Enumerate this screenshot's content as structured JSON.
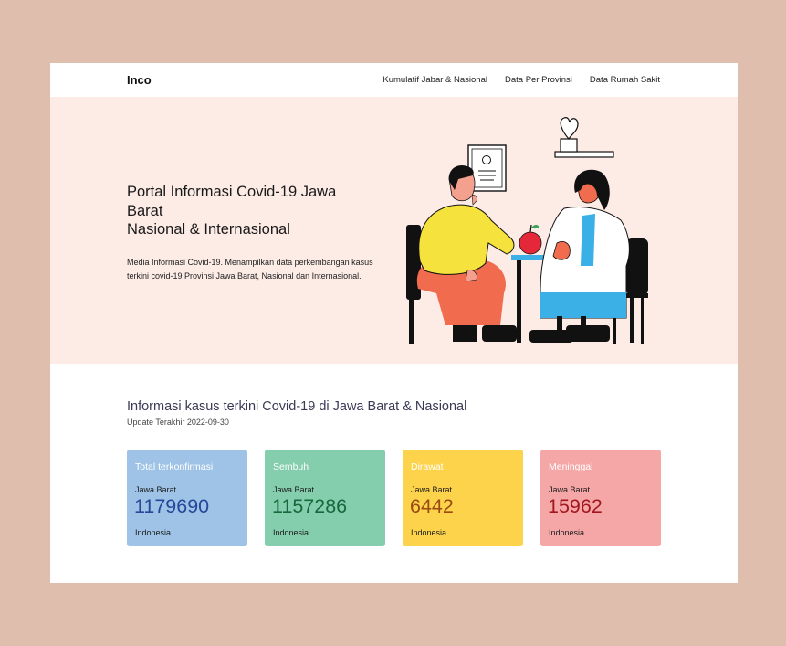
{
  "nav": {
    "brand": "Inco",
    "links": [
      "Kumulatif Jabar & Nasional",
      "Data Per Provinsi",
      "Data Rumah Sakit"
    ]
  },
  "hero": {
    "title_lines": [
      "Portal Informasi Covid-19 Jawa",
      "Barat",
      "Nasional & Internasional"
    ],
    "description": "Media Informasi Covid-19. Menampilkan data perkembangan kasus terkini covid-19 Provinsi Jawa Barat, Nasional dan Internasional."
  },
  "info": {
    "title": "Informasi kasus terkini Covid-19 di Jawa Barat & Nasional",
    "update": "Update Terakhir 2022-09-30"
  },
  "cards": [
    {
      "title": "Total terkonfirmasi",
      "region": "Jawa Barat",
      "value": "1179690",
      "footer": "Indonesia",
      "bg": "#9ec3e6",
      "value_color": "#27479a"
    },
    {
      "title": "Sembuh",
      "region": "Jawa Barat",
      "value": "1157286",
      "footer": "Indonesia",
      "bg": "#84cdad",
      "value_color": "#16693c"
    },
    {
      "title": "Dirawat",
      "region": "Jawa Barat",
      "value": "6442",
      "footer": "Indonesia",
      "bg": "#fcd34b",
      "value_color": "#9a4a12"
    },
    {
      "title": "Meninggal",
      "region": "Jawa Barat",
      "value": "15962",
      "footer": "Indonesia",
      "bg": "#f5a7a8",
      "value_color": "#a3161f"
    }
  ],
  "colors": {
    "page_bg": "#e0beae",
    "hero_bg": "#fdece6"
  }
}
